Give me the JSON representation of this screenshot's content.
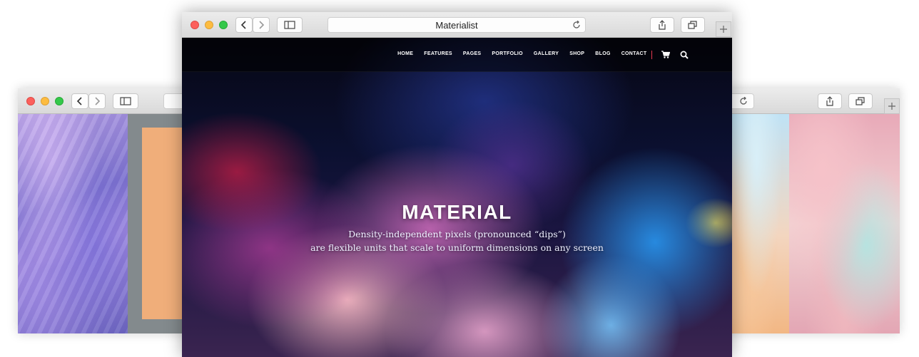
{
  "front_window": {
    "address_title": "Materialist",
    "nav": {
      "items": [
        "HOME",
        "FEATURES",
        "PAGES",
        "PORTFOLIO",
        "GALLERY",
        "SHOP",
        "BLOG",
        "CONTACT"
      ],
      "icons": [
        "cart-icon",
        "search-icon"
      ],
      "separator_color": "#e53950"
    },
    "hero": {
      "title": "MATERIAL",
      "subtitle_line1": "Density-independent pixels (pronounced “dips”)",
      "subtitle_line2": "are flexible units that scale to uniform dimensions on any screen"
    }
  },
  "back_windows": {
    "left": {
      "visible_controls": [
        "close",
        "minimize",
        "zoom",
        "back",
        "forward",
        "sidebar"
      ]
    },
    "right": {
      "visible_controls": [
        "reload",
        "share",
        "tabs",
        "new-tab"
      ]
    }
  },
  "colors": {
    "traffic_red": "#fc605c",
    "traffic_yellow": "#fdbc40",
    "traffic_green": "#34c84a"
  }
}
